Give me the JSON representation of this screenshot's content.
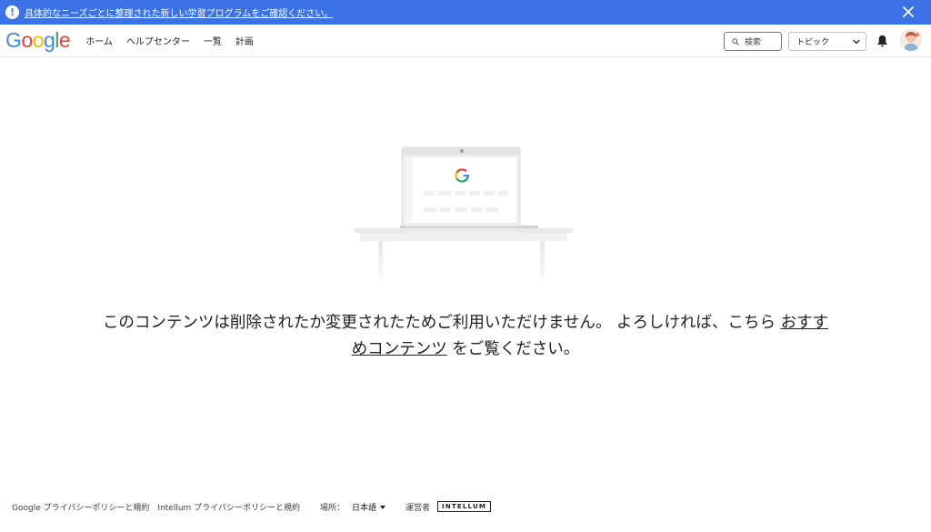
{
  "banner": {
    "text": "具体的なニーズごとに整理された新しい学習プログラムをご確認ください。",
    "info_symbol": "!",
    "color": "#3b73e6"
  },
  "header": {
    "logo": [
      "G",
      "o",
      "o",
      "g",
      "l",
      "e"
    ],
    "logo_colors": [
      "#4285f4",
      "#ea4335",
      "#fbbc05",
      "#4285f4",
      "#34a853",
      "#ea4335"
    ],
    "nav": [
      "ホーム",
      "ヘルプセンター",
      "一覧",
      "計画"
    ],
    "search_label": "検索",
    "topic_select": "トピック"
  },
  "message": {
    "part1": "このコンテンツは削除されたか変更されたためご利用いただけません。 よろしければ、こちら",
    "link": "おすすめコンテンツ",
    "part2": "をご覧ください。"
  },
  "footer": {
    "google_privacy": "Google プライバシーポリシーと規約",
    "intellum_privacy": "Intellum プライバシーポリシーと規約",
    "location_label": "場所：",
    "language": "日本語",
    "operator_label": "運営者",
    "operator_logo": "INTELLUM"
  }
}
